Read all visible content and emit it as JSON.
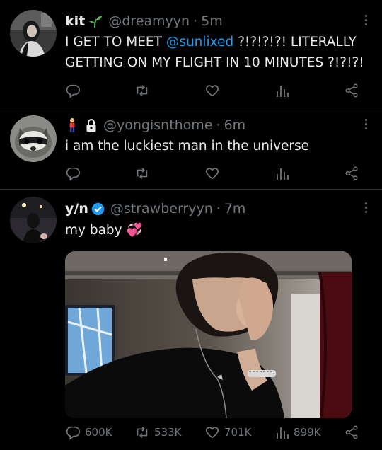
{
  "tweets": [
    {
      "name": "kit",
      "handle": "@dreamyyn",
      "time": "5m",
      "text_before": "I GET TO MEET ",
      "mention": "@sunlixed",
      "text_after": " ?!?!?!?! LITERALLY GETTING ON MY FLIGHT IN 10 MINUTES ?!?!?!",
      "stats": {
        "reply": "",
        "retweet": "",
        "like": "",
        "views": ""
      }
    },
    {
      "name": "",
      "handle": "@yongisnthome",
      "time": "6m",
      "text": "i am the luckiest man in the universe",
      "stats": {
        "reply": "",
        "retweet": "",
        "like": "",
        "views": ""
      }
    },
    {
      "name": "y/n",
      "handle": "@strawberryyn",
      "time": "7m",
      "text": "my baby 💞",
      "stats": {
        "reply": "600K",
        "retweet": "533K",
        "like": "701K",
        "views": "899K"
      }
    }
  ],
  "icons": {
    "sprout": "sprout-icon",
    "person": "person-emoji-icon",
    "lock": "lock-icon",
    "verified": "verified-badge-icon",
    "more": "more-icon",
    "reply": "reply-icon",
    "retweet": "retweet-icon",
    "like": "heart-icon",
    "views": "views-icon",
    "share": "share-icon"
  },
  "colors": {
    "accent": "#1d9bf0",
    "muted": "#71767b",
    "text": "#e7e9ea",
    "divider": "#2f3336"
  }
}
